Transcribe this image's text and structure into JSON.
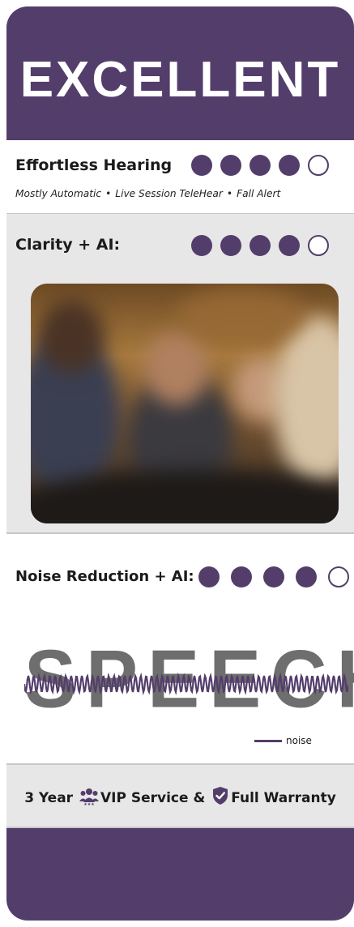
{
  "header": {
    "title": "EXCELLENT"
  },
  "features": {
    "effortless": {
      "title": "Effortless Hearing",
      "rating": {
        "filled": 4,
        "total": 5
      },
      "highlights": [
        "Mostly Automatic",
        "Live Session TeleHear",
        "Fall Alert"
      ]
    },
    "clarity": {
      "title": "Clarity + AI:",
      "rating": {
        "filled": 4,
        "total": 5
      },
      "image": "people-talking-in-restaurant-photo"
    },
    "noise": {
      "title": "Noise Reduction + AI:",
      "rating": {
        "filled": 4,
        "total": 5
      },
      "graphic_text": "SPEECH",
      "legend_label": "noise"
    }
  },
  "footer": {
    "years": "3 Year",
    "vip": "VIP Service &",
    "warranty": "Full Warranty",
    "vip_icon": "people-group-icon",
    "warranty_icon": "shield-check-icon"
  },
  "colors": {
    "brand": "#533e6b",
    "panel": "#e8e7e8",
    "speech": "#6e6e6e"
  }
}
